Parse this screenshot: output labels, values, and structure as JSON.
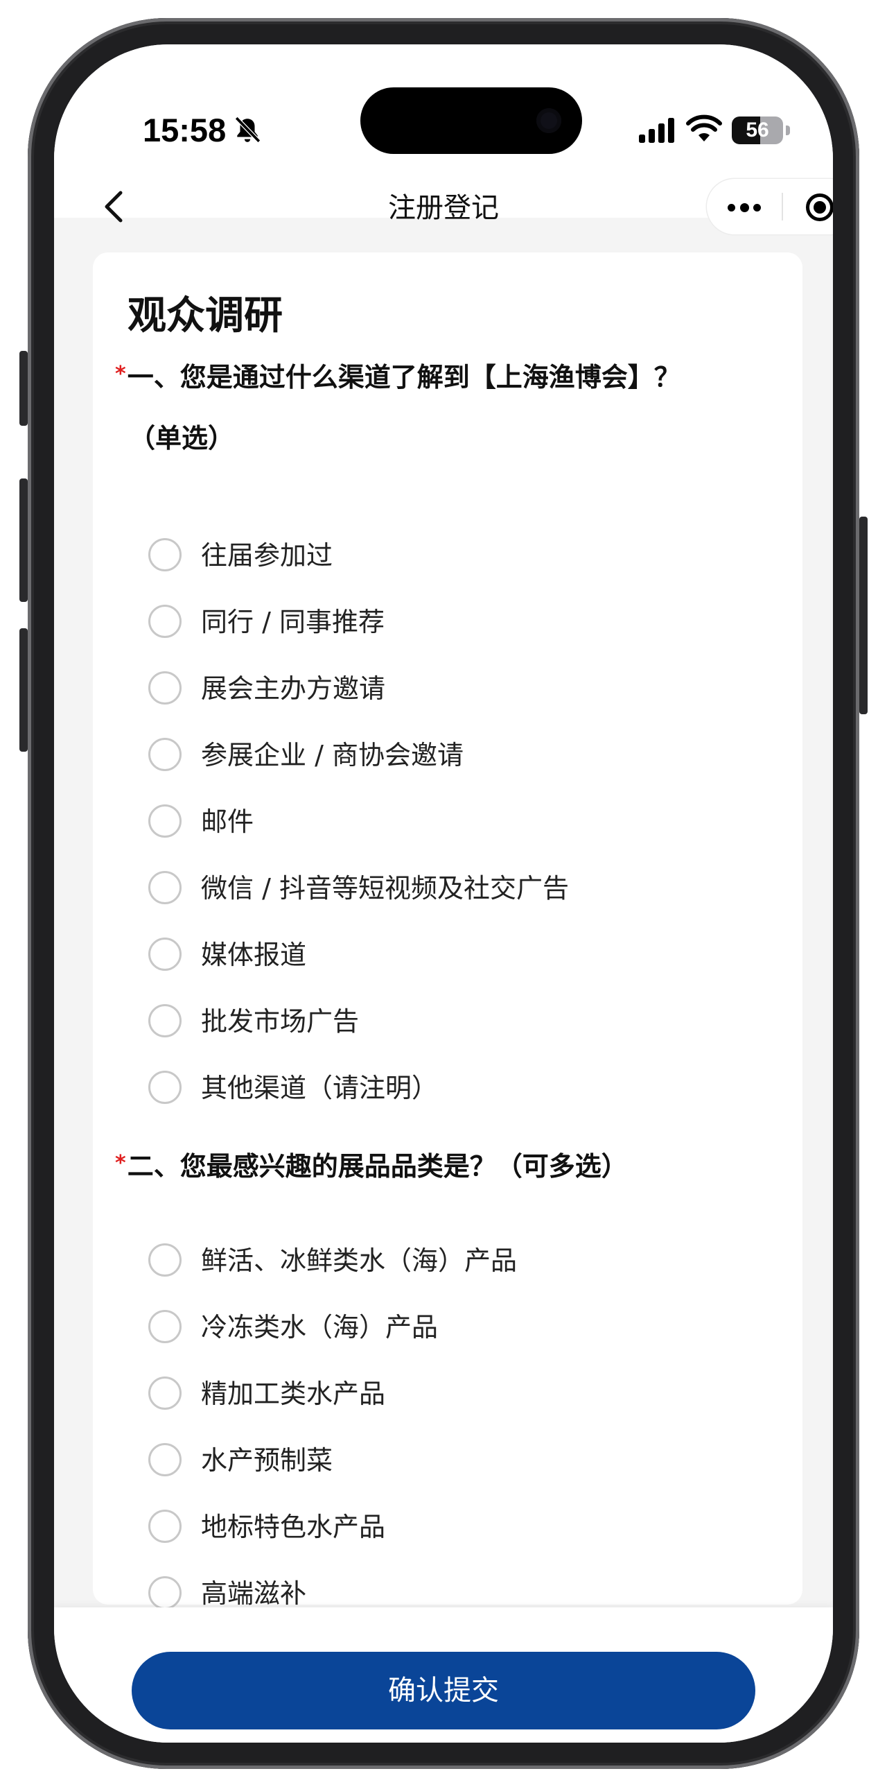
{
  "status_bar": {
    "time": "15:58",
    "battery_level": "56",
    "battery_fraction": 0.56,
    "icons": [
      "bell-slash-icon",
      "signal-icon",
      "wifi-icon",
      "battery-icon"
    ]
  },
  "nav": {
    "title": "注册登记",
    "back_icon": "chevron-left-icon",
    "more_icon": "more-dots-icon",
    "close_icon": "target-close-icon"
  },
  "survey": {
    "title": "观众调研",
    "questions": [
      {
        "required_mark": "*",
        "title_line1": "一、您是通过什么渠道了解到【上海渔博会】？",
        "title_line2": "（单选）",
        "options": [
          "往届参加过",
          "同行 / 同事推荐",
          "展会主办方邀请",
          "参展企业 / 商协会邀请",
          "邮件",
          "微信 / 抖音等短视频及社交广告",
          "媒体报道",
          "批发市场广告",
          "其他渠道（请注明）"
        ]
      },
      {
        "required_mark": "*",
        "title_line1": "二、您最感兴趣的展品品类是？（可多选）",
        "options": [
          "鲜活、冰鲜类水（海）产品",
          "冷冻类水（海）产品",
          "精加工类水产品",
          "水产预制菜",
          "地标特色水产品",
          "高端滋补"
        ]
      }
    ]
  },
  "footer": {
    "submit_label": "确认提交"
  },
  "colors": {
    "primary_button": "#0a4598",
    "required_mark": "#e02020",
    "radio_border": "#c8c8c8",
    "page_background": "#f4f4f4"
  }
}
